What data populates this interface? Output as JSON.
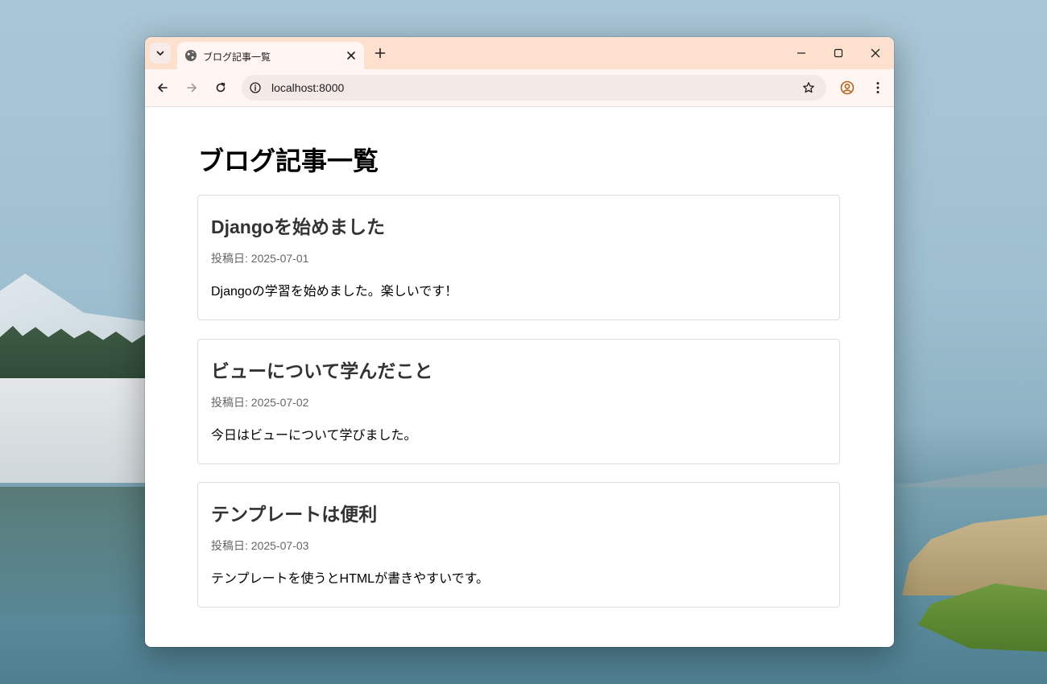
{
  "browser": {
    "tab": {
      "title": "ブログ記事一覧"
    },
    "address_bar": {
      "url": "localhost:8000"
    }
  },
  "page": {
    "heading": "ブログ記事一覧",
    "posts": [
      {
        "title": "Djangoを始めました",
        "date": "投稿日: 2025-07-01",
        "body": "Djangoの学習を始めました。楽しいです！"
      },
      {
        "title": "ビューについて学んだこと",
        "date": "投稿日: 2025-07-02",
        "body": "今日はビューについて学びました。"
      },
      {
        "title": "テンプレートは便利",
        "date": "投稿日: 2025-07-03",
        "body": "テンプレートを使うとHTMLが書きやすいです。"
      }
    ]
  },
  "icons": {
    "tab_search": "chevron-down-icon",
    "favicon": "globe-icon",
    "tab_close": "close-icon",
    "new_tab": "plus-icon",
    "minimize": "minimize-icon",
    "maximize": "maximize-icon",
    "close_window": "close-icon",
    "back": "arrow-left-icon",
    "forward": "arrow-right-icon",
    "reload": "reload-icon",
    "site_info": "info-icon",
    "bookmark": "star-icon",
    "profile": "profile-icon",
    "menu": "kebab-menu-icon"
  },
  "colors": {
    "tabstrip": "#fde0cd",
    "toolbar": "#fff6f3",
    "profile_accent": "#b5651d"
  }
}
